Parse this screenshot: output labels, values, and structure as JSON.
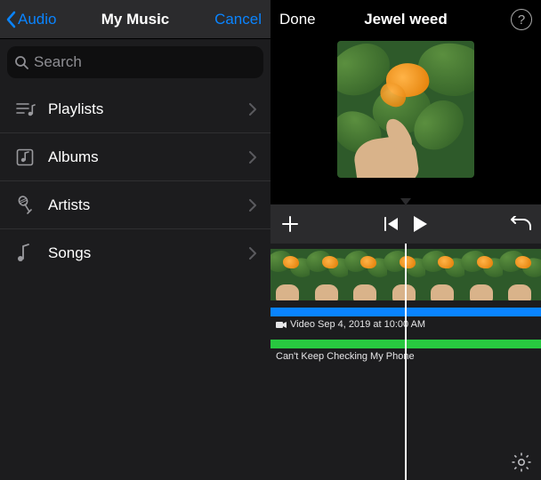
{
  "left": {
    "back_label": "Audio",
    "title": "My Music",
    "cancel_label": "Cancel",
    "search_placeholder": "Search",
    "items": [
      {
        "icon": "playlists-icon",
        "label": "Playlists"
      },
      {
        "icon": "albums-icon",
        "label": "Albums"
      },
      {
        "icon": "artists-icon",
        "label": "Artists"
      },
      {
        "icon": "songs-icon",
        "label": "Songs"
      }
    ]
  },
  "right": {
    "done_label": "Done",
    "title": "Jewel weed",
    "help_label": "?",
    "video_track_label": "Video Sep 4, 2019 at 10:00 AM",
    "audio_track_label": "Can't Keep Checking My Phone"
  },
  "colors": {
    "accent_blue": "#0a84ff",
    "track_blue": "#0a84ff",
    "track_green": "#28c840"
  }
}
